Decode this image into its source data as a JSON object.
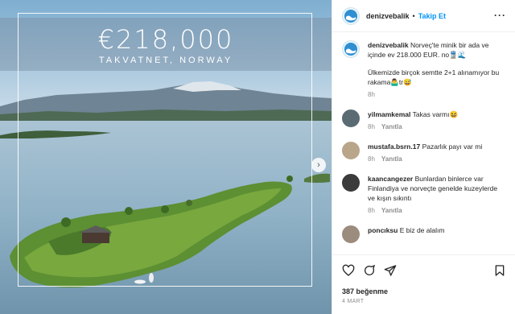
{
  "post": {
    "price": "€218,000",
    "location": "TAKVATNET, NORWAY"
  },
  "header": {
    "username": "denizvebalik",
    "separator": "•",
    "follow_label": "Takip Et",
    "more_label": "···"
  },
  "caption": {
    "username": "denizvebalik",
    "text_1": "Norveç'te minik bir ada ve içinde ev 218.000 EUR.",
    "text_1_emoji": "no🚆🌊",
    "text_2": "Ülkemizde birçok semtte 2+1 alınamıyor bu rakama",
    "text_2_emoji": "🤷‍♂️tr😅",
    "time": "8h"
  },
  "comments": [
    {
      "username": "yilmamkemal",
      "text": "Takas varmı😆",
      "time": "8h",
      "reply": "Yanıtla",
      "avatar_color": "#5a6b73"
    },
    {
      "username": "mustafa.bsrn.17",
      "text": "Pazarlık payı var mi",
      "time": "8h",
      "reply": "Yanıtla",
      "avatar_color": "#b9a58a"
    },
    {
      "username": "kaancangezer",
      "text": "Bunlardan binlerce var Finlandiya ve norveçte genelde kuzeylerde ve kışın sıkıntı",
      "time": "8h",
      "reply": "Yanıtla",
      "avatar_color": "#3b3b3b"
    },
    {
      "username": "poncıksu",
      "text": "E biz de alalım",
      "time": "",
      "reply": "",
      "avatar_color": "#9c8c7d"
    }
  ],
  "footer": {
    "likes": "387 beğenme",
    "date": "4 MART"
  },
  "colors": {
    "accent": "#0095f6",
    "muted": "#8e8e8e",
    "border": "#efefef"
  },
  "icons": [
    "heart-icon",
    "comment-icon",
    "share-icon",
    "bookmark-icon",
    "chevron-right-icon",
    "more-icon"
  ]
}
